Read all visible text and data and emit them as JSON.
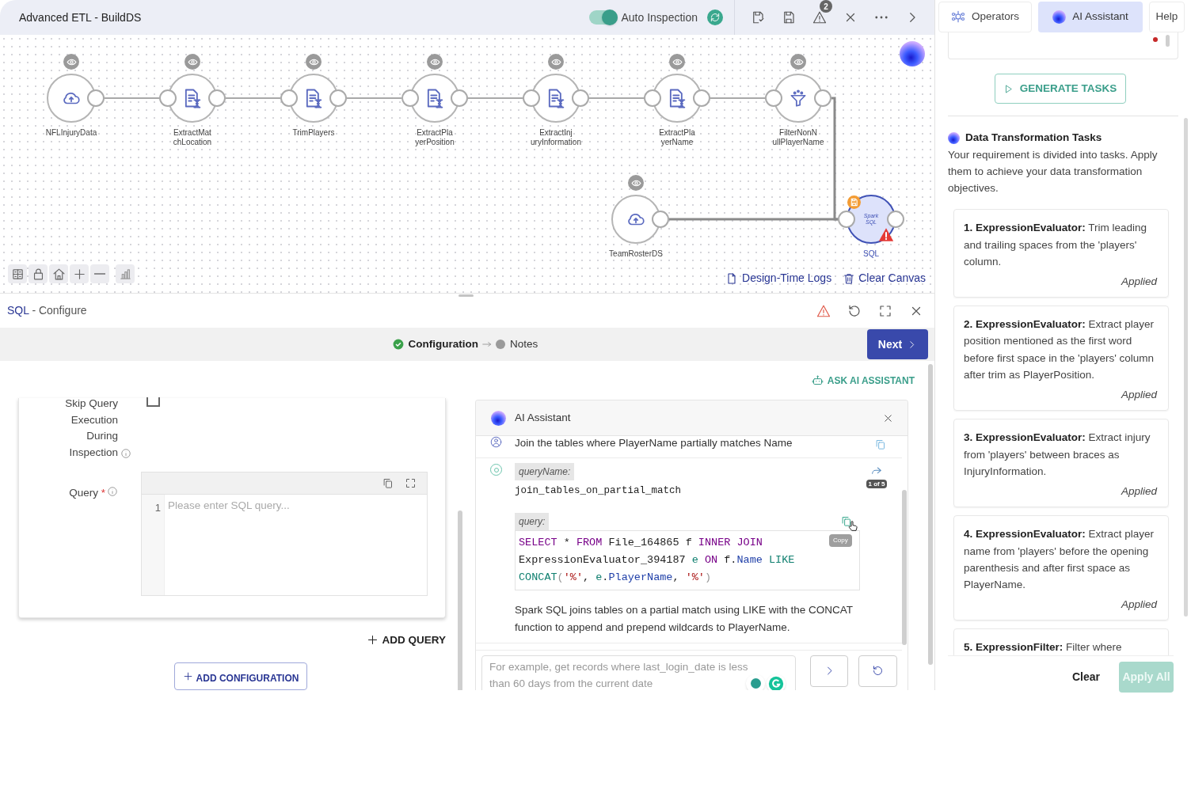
{
  "header": {
    "title": "Advanced ETL - BuildDS",
    "auto_inspection": {
      "label": "Auto Inspection",
      "on": true
    },
    "alerts_badge": "2"
  },
  "canvas": {
    "nodes": [
      {
        "kind": "source",
        "label_lines": [
          "NFLInjuryData"
        ],
        "selected": false
      },
      {
        "kind": "operator",
        "label_lines": [
          "ExtractMat",
          "chLocation"
        ],
        "selected": false
      },
      {
        "kind": "operator",
        "label_lines": [
          "TrimPlayers"
        ],
        "selected": false
      },
      {
        "kind": "operator",
        "label_lines": [
          "ExtractPla",
          "yerPosition"
        ],
        "selected": false
      },
      {
        "kind": "operator",
        "label_lines": [
          "ExtractInj",
          "uryInformation"
        ],
        "selected": false
      },
      {
        "kind": "operator",
        "label_lines": [
          "ExtractPla",
          "yerName"
        ],
        "selected": false
      },
      {
        "kind": "filter",
        "label_lines": [
          "FilterNonN",
          "ullPlayerName"
        ],
        "selected": false
      },
      {
        "kind": "source",
        "label_lines": [
          "TeamRosterDS"
        ],
        "selected": false
      },
      {
        "kind": "sql",
        "label_lines": [
          "SQL"
        ],
        "logo_lines": [
          "Spark",
          "SQL"
        ],
        "selected": true,
        "warning": true,
        "unsaved": true
      }
    ],
    "links": [
      "Design-Time Logs",
      "Clear Canvas"
    ]
  },
  "configure": {
    "node": "SQL",
    "suffix": "- Configure",
    "steps": [
      {
        "label": "Configuration",
        "done": true,
        "selected": true
      },
      {
        "label": "Notes",
        "done": false,
        "selected": false
      }
    ],
    "next": "Next"
  },
  "form": {
    "skip_label_lines": [
      "Skip Query",
      "Execution",
      "During",
      "Inspection"
    ],
    "skip_checked": false,
    "query_label": "Query",
    "required_mark": "*",
    "line_number": "1",
    "query_placeholder": "Please enter SQL query...",
    "add_query": "ADD QUERY",
    "add_configuration": "ADD CONFIGURATION"
  },
  "assistant": {
    "ask": "ASK AI ASSISTANT",
    "title": "AI Assistant",
    "user_message": "Join the tables where PlayerName partially matches Name",
    "query_name_label": "queryName:",
    "query_name": "join_tables_on_partial_match",
    "pager": "1 of 5",
    "query_label": "query:",
    "tooltip": "Copy",
    "code_lines": [
      [
        {
          "kind": "keyword",
          "text": "SELECT"
        },
        {
          "kind": "plain",
          "text": " * "
        },
        {
          "kind": "keyword",
          "text": "FROM"
        },
        {
          "kind": "plain",
          "text": " File_164865 f "
        },
        {
          "kind": "keyword",
          "text": "INNER JOIN"
        }
      ],
      [
        {
          "kind": "plain",
          "text": "ExpressionEvaluator_394187 "
        },
        {
          "kind": "func",
          "text": "e"
        },
        {
          "kind": "keyword",
          "text": " ON"
        },
        {
          "kind": "plain",
          "text": " f."
        },
        {
          "kind": "prop",
          "text": "Name"
        },
        {
          "kind": "func",
          "text": " LIKE"
        }
      ],
      [
        {
          "kind": "func",
          "text": "CONCAT"
        },
        {
          "kind": "punct",
          "text": "("
        },
        {
          "kind": "string",
          "text": "'%'"
        },
        {
          "kind": "plain",
          "text": ", "
        },
        {
          "kind": "func",
          "text": "e"
        },
        {
          "kind": "plain",
          "text": "."
        },
        {
          "kind": "prop",
          "text": "PlayerName"
        },
        {
          "kind": "plain",
          "text": ", "
        },
        {
          "kind": "string",
          "text": "'%'"
        },
        {
          "kind": "punct",
          "text": ")"
        }
      ]
    ],
    "explanation": "Spark SQL joins tables on a partial match using LIKE with the CONCAT function to append and prepend wildcards to PlayerName.",
    "input_placeholder": "For example, get records where last_login_date is less than 60 days from the current date"
  },
  "side": {
    "tabs": [
      {
        "label": "Operators",
        "selected": false
      },
      {
        "label": "AI Assistant",
        "selected": true
      },
      {
        "label": "Help",
        "selected": false
      }
    ],
    "generate": "GENERATE TASKS",
    "heading": "Data Transformation Tasks",
    "intro": "Your requirement is divided into tasks. Apply them to achieve your data transformation objectives.",
    "tasks": [
      {
        "text": "**1. ExpressionEvaluator:** Trim leading and trailing spaces from the 'players' column.",
        "status": "Applied"
      },
      {
        "text": "**2. ExpressionEvaluator:** Extract player position mentioned as the first word before first space in the 'players' column after trim as PlayerPosition.",
        "status": "Applied"
      },
      {
        "text": "**3. ExpressionEvaluator:** Extract injury from 'players' between braces as InjuryInformation.",
        "status": "Applied"
      },
      {
        "text": "**4. ExpressionEvaluator:** Extract player name from 'players' before the opening parenthesis and after first space as PlayerName.",
        "status": "Applied"
      },
      {
        "text": "**5. ExpressionFilter:** Filter where"
      }
    ],
    "clear": "Clear",
    "apply_all": "Apply All",
    "apply_all_disabled": true
  }
}
